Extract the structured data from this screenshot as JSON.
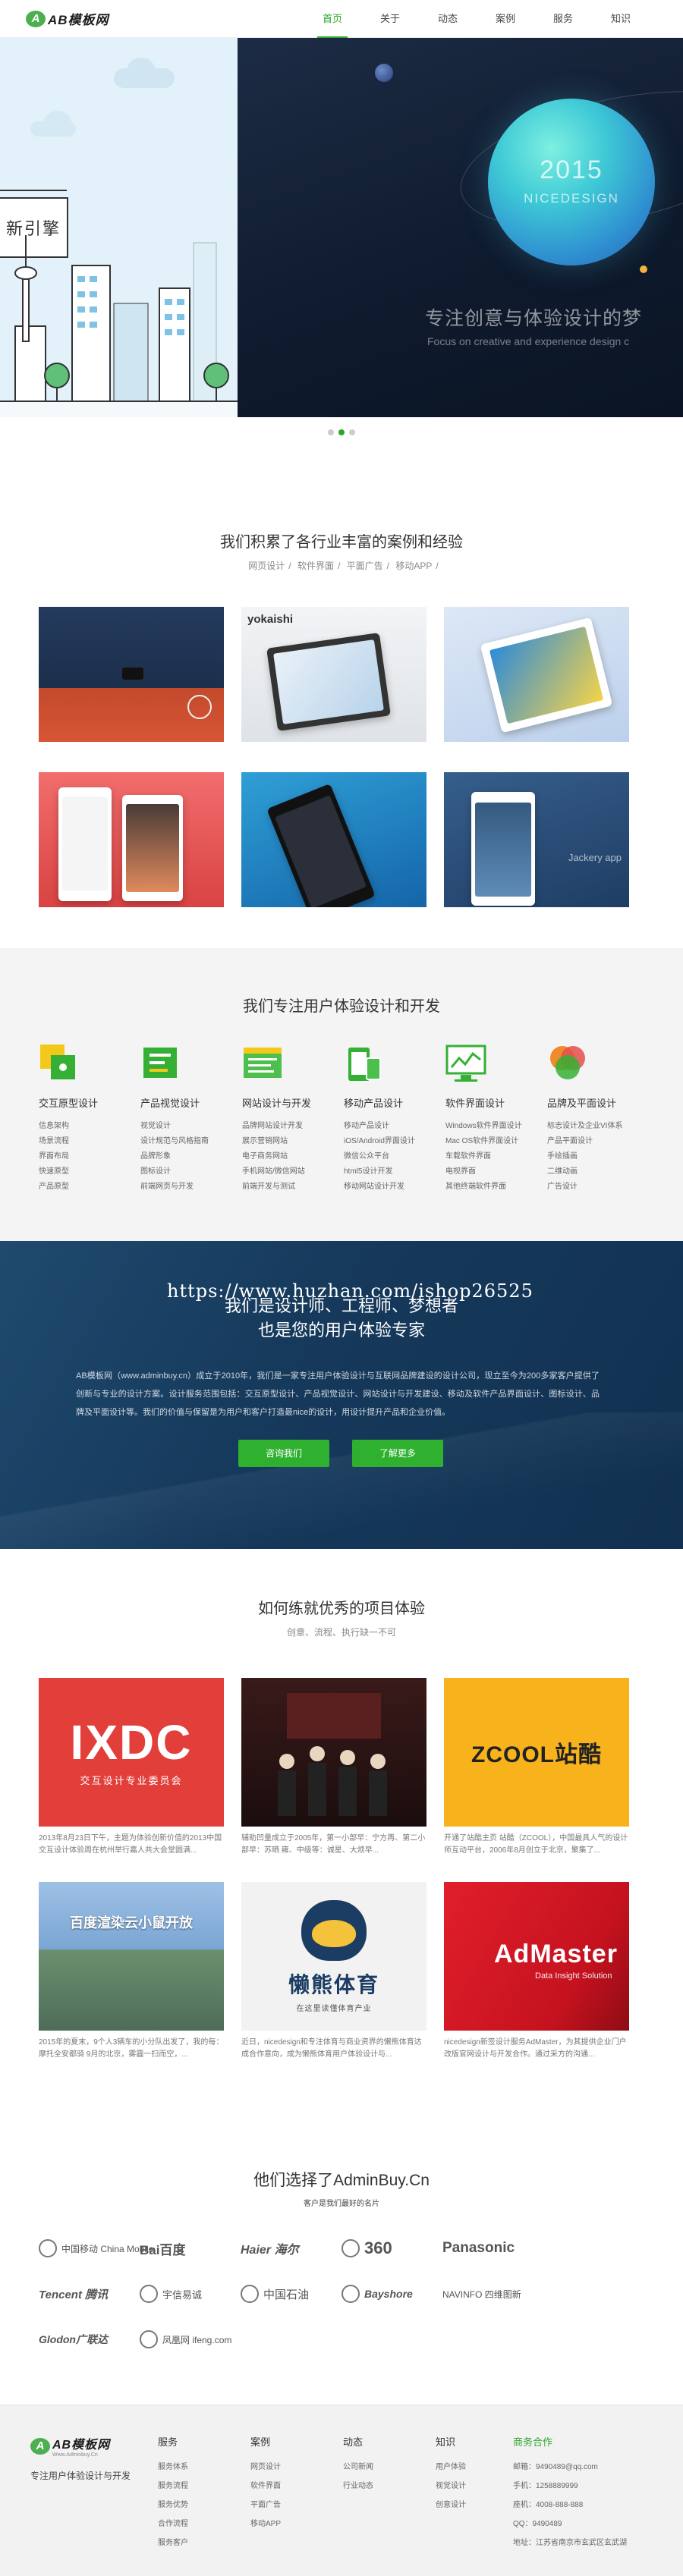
{
  "header": {
    "logo_mark": "A",
    "logo_text": "AB模板网",
    "nav": [
      "首页",
      "关于",
      "动态",
      "案例",
      "服务",
      "知识"
    ],
    "active_index": 0
  },
  "hero": {
    "left_sign": "新引擎",
    "planet_year": "2015",
    "planet_name": "NICEDESIGN",
    "slogan": "专注创意与体验设计的梦",
    "slogan_en": "Focus on creative and experience design c",
    "slide_count": 3,
    "active_slide": 1
  },
  "cases": {
    "title": "我们积累了各行业丰富的案例和经验",
    "tags": [
      "网页设计",
      "软件界面",
      "平面广告",
      "移动APP"
    ],
    "card_labels": [
      "yokaishi",
      "Jackery app"
    ]
  },
  "services": {
    "title": "我们专注用户体验设计和开发",
    "columns": [
      {
        "title": "交互原型设计",
        "icon": "prototype-icon",
        "color": "#f2c81b",
        "items": [
          "信息架构",
          "场景流程",
          "界面布局",
          "快速原型",
          "产品原型"
        ]
      },
      {
        "title": "产品视觉设计",
        "icon": "visual-design-icon",
        "color": "#35b035",
        "items": [
          "视觉设计",
          "设计规范与风格指南",
          "品牌形象",
          "图标设计",
          "前端网页与开发"
        ]
      },
      {
        "title": "网站设计与开发",
        "icon": "website-icon",
        "color": "#4cbf4c",
        "items": [
          "品牌网站设计开发",
          "展示营销网站",
          "电子商务网站",
          "手机网站/微信网站",
          "前端开发与测试"
        ]
      },
      {
        "title": "移动产品设计",
        "icon": "mobile-icon",
        "color": "#35b035",
        "items": [
          "移动产品设计",
          "iOS/Android界面设计",
          "微信公众平台",
          "html5设计开发",
          "移动网站设计开发"
        ]
      },
      {
        "title": "软件界面设计",
        "icon": "software-ui-icon",
        "color": "#35b035",
        "items": [
          "Windows软件界面设计",
          "Mac OS软件界面设计",
          "车载软件界面",
          "电视界面",
          "其他终端软件界面"
        ]
      },
      {
        "title": "品牌及平面设计",
        "icon": "brand-icon",
        "color": "#f08a2c",
        "items": [
          "标志设计及企业VI体系",
          "产品平面设计",
          "手绘插画",
          "二维动画",
          "广告设计"
        ]
      }
    ]
  },
  "about": {
    "watermark": "https://www.huzhan.com/ishop26525",
    "headline1": "我们是设计师、工程师、梦想者",
    "headline2": "也是您的用户体验专家",
    "text": "AB模板网（www.adminbuy.cn）成立于2010年，我们是一家专注用户体验设计与互联网品牌建设的设计公司，现立至今为200多家客户提供了创新与专业的设计方案。设计服务范围包括：交互原型设计、产品视觉设计、网站设计与开发建设、移动及软件产品界面设计、图标设计、品牌及平面设计等。我们的价值与保留是为用户和客户打造最nice的设计，用设计提升产品和企业价值。",
    "btn_contact": "咨询我们",
    "btn_more": "了解更多"
  },
  "projects": {
    "title": "如何练就优秀的项目体验",
    "subtitle": "创意、流程、执行缺一不可",
    "items": [
      {
        "logo_big": "IXDC",
        "logo_small": "交互设计专业委员会",
        "text": "2013年8月23日下午，主题为体验创新价值的2013中国交互设计体验周在杭州举行嘉人共大会堂圆满..."
      },
      {
        "logo_big": "",
        "logo_small": "",
        "text": "辅助凹量成立于2005年，第一小部早：宁方再、第二小部早：苏晒 雍、中级等：诚星、大烦早..."
      },
      {
        "logo_big": "ZCOOL站酷",
        "logo_small": "",
        "text": "开通了站酷主页 站酷（ZCOOL），中国最具人气的设计师互动平台，2006年8月创立于北京，聚集了..."
      },
      {
        "logo_big": "百度渲染云小鼠开放",
        "logo_small": "",
        "text": "2015年的夏末，9个人3辆车的小分队出发了，我的每：摩托全安都骑 9月的北京，雾霾一扫而空，..."
      },
      {
        "logo_big": "懒熊体育",
        "logo_small": "在这里读懂体育产业",
        "text": "近日，nicedesign和专注体育与商业资界的懒熊体育达成合作意向，成为懒熊体育用户体验设计与..."
      },
      {
        "logo_big": "AdMaster",
        "logo_small": "Data Insight Solution",
        "text": "nicedesign新签设计服务AdMaster，为其提供企业门户改版官网设计与开发合作。通过采方的沟通..."
      }
    ]
  },
  "partners": {
    "title": "他们选择了AdminBuy.Cn",
    "subtitle": "客户是我们最好的名片",
    "logos": [
      "中国移动 China Mobile",
      "Bai百度",
      "Haier 海尔",
      "360",
      "Panasonic",
      "Tencent 腾讯",
      "宇信易诚",
      "中国石油",
      "Bayshore",
      "NAVINFO 四维图新",
      "Glodon广联达",
      "凤凰网 ifeng.com"
    ]
  },
  "footer": {
    "logo_text": "AB模板网",
    "logo_sub": "Www.Adminbuy.Cn",
    "slogan": "专注用户体验设计与开发",
    "columns": [
      {
        "title": "服务",
        "items": [
          "服务体系",
          "服务流程",
          "服务优势",
          "合作流程",
          "服务客户"
        ]
      },
      {
        "title": "案例",
        "items": [
          "网页设计",
          "软件界面",
          "平面广告",
          "移动APP"
        ]
      },
      {
        "title": "动态",
        "items": [
          "公司新闻",
          "行业动态"
        ]
      },
      {
        "title": "知识",
        "items": [
          "用户体验",
          "视觉设计",
          "创意设计"
        ]
      }
    ],
    "contact": {
      "title": "商务合作",
      "items": [
        "邮箱：9490489@qq.com",
        "手机：1258889999",
        "座机：4008-888-888",
        "QQ：9490489",
        "地址：江苏省南京市玄武区玄武湖"
      ]
    }
  }
}
